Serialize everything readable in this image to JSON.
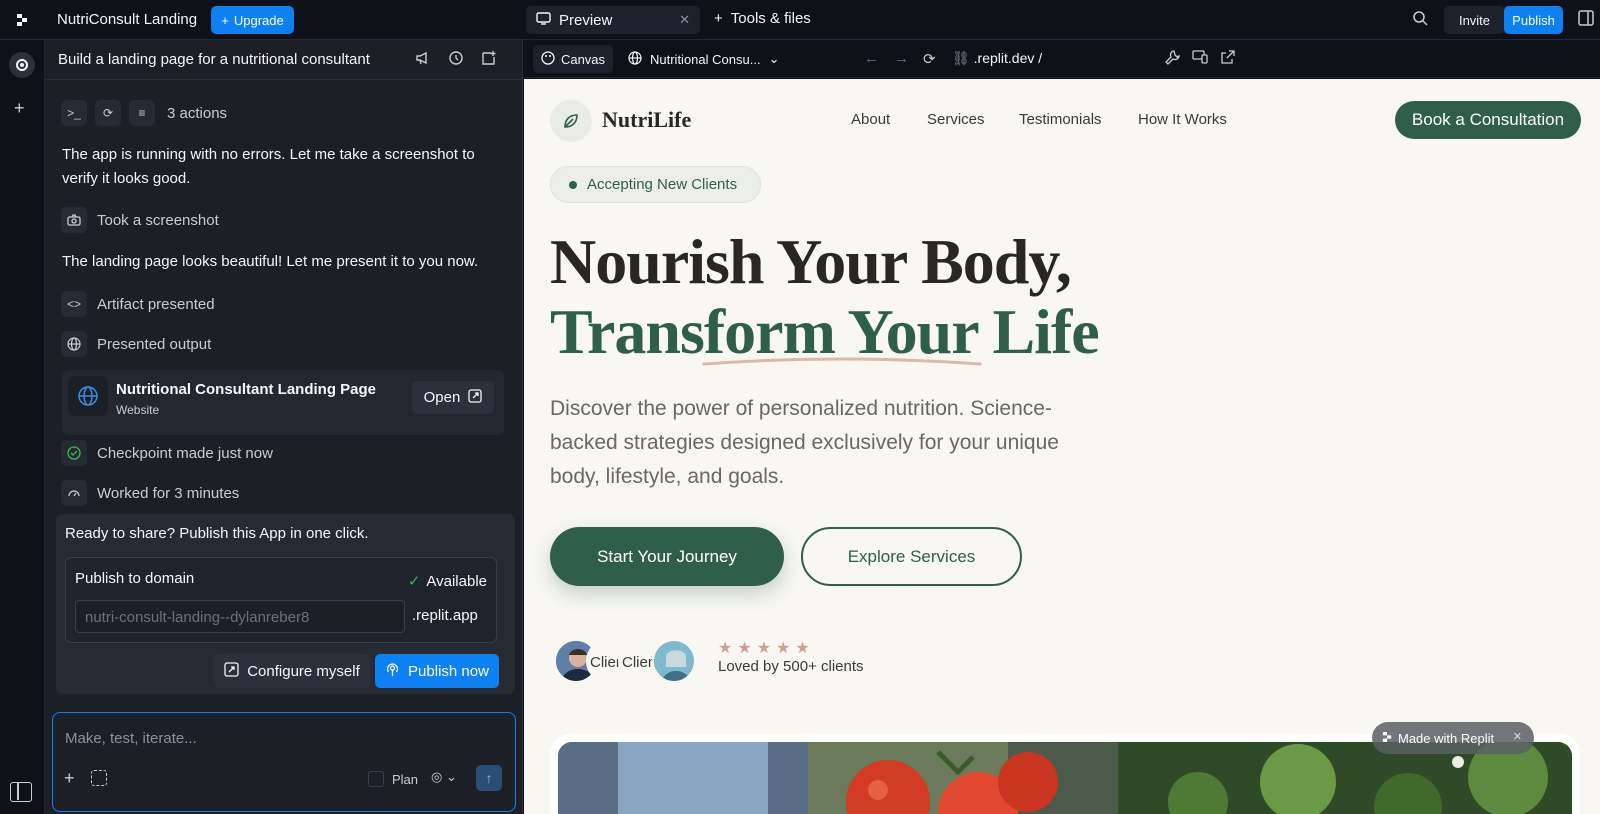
{
  "topbar": {
    "app_title": "NutriConsult Landing",
    "upgrade_label": "Upgrade",
    "preview_tab": "Preview",
    "tools_tab": "Tools & files",
    "invite_label": "Invite",
    "publish_label": "Publish"
  },
  "chat": {
    "title": "Build a landing page for a nutritional consultant",
    "actions_count": "3 actions",
    "msg1": "The app is running with no errors. Let me take a screenshot to verify it looks good.",
    "step_screenshot": "Took a screenshot",
    "msg2": "The landing page looks beautiful! Let me present it to you now.",
    "step_artifact": "Artifact presented",
    "step_output": "Presented output",
    "artifact_title": "Nutritional Consultant Landing Page",
    "artifact_type": "Website",
    "open_label": "Open",
    "step_checkpoint": "Checkpoint made just now",
    "step_worked": "Worked for 3 minutes",
    "share_prompt": "Ready to share? Publish this App in one click.",
    "domain_label": "Publish to domain",
    "available": "Available",
    "domain_placeholder": "nutri-consult-landing--dylanreber8",
    "domain_suffix": ".replit.app",
    "configure_label": "Configure myself",
    "publish_now_label": "Publish now",
    "composer_placeholder": "Make, test, iterate...",
    "plan_label": "Plan"
  },
  "browser": {
    "canvas_label": "Canvas",
    "page_select": "Nutritional Consu...",
    "url": ".replit.dev /"
  },
  "site": {
    "brand": "NutriLife",
    "nav": [
      "About",
      "Services",
      "Testimonials",
      "How It Works"
    ],
    "book_label": "Book a Consultation",
    "badge": "Accepting New Clients",
    "headline1": "Nourish Your Body,",
    "headline2": "Transform Your Life",
    "subtext": "Discover the power of personalized nutrition. Science-backed strategies designed exclusively for your unique body, lifestyle, and goals.",
    "cta_primary": "Start Your Journey",
    "cta_secondary": "Explore Services",
    "broken_avatar_alt": "Clien",
    "stars": "★★★★★",
    "loved": "Loved by 500+ clients",
    "made_with": "Made with Replit"
  },
  "colors": {
    "accent_blue": "#0d80f2",
    "brand_green": "#2f5f4b",
    "page_bg": "#f8f7f2"
  }
}
